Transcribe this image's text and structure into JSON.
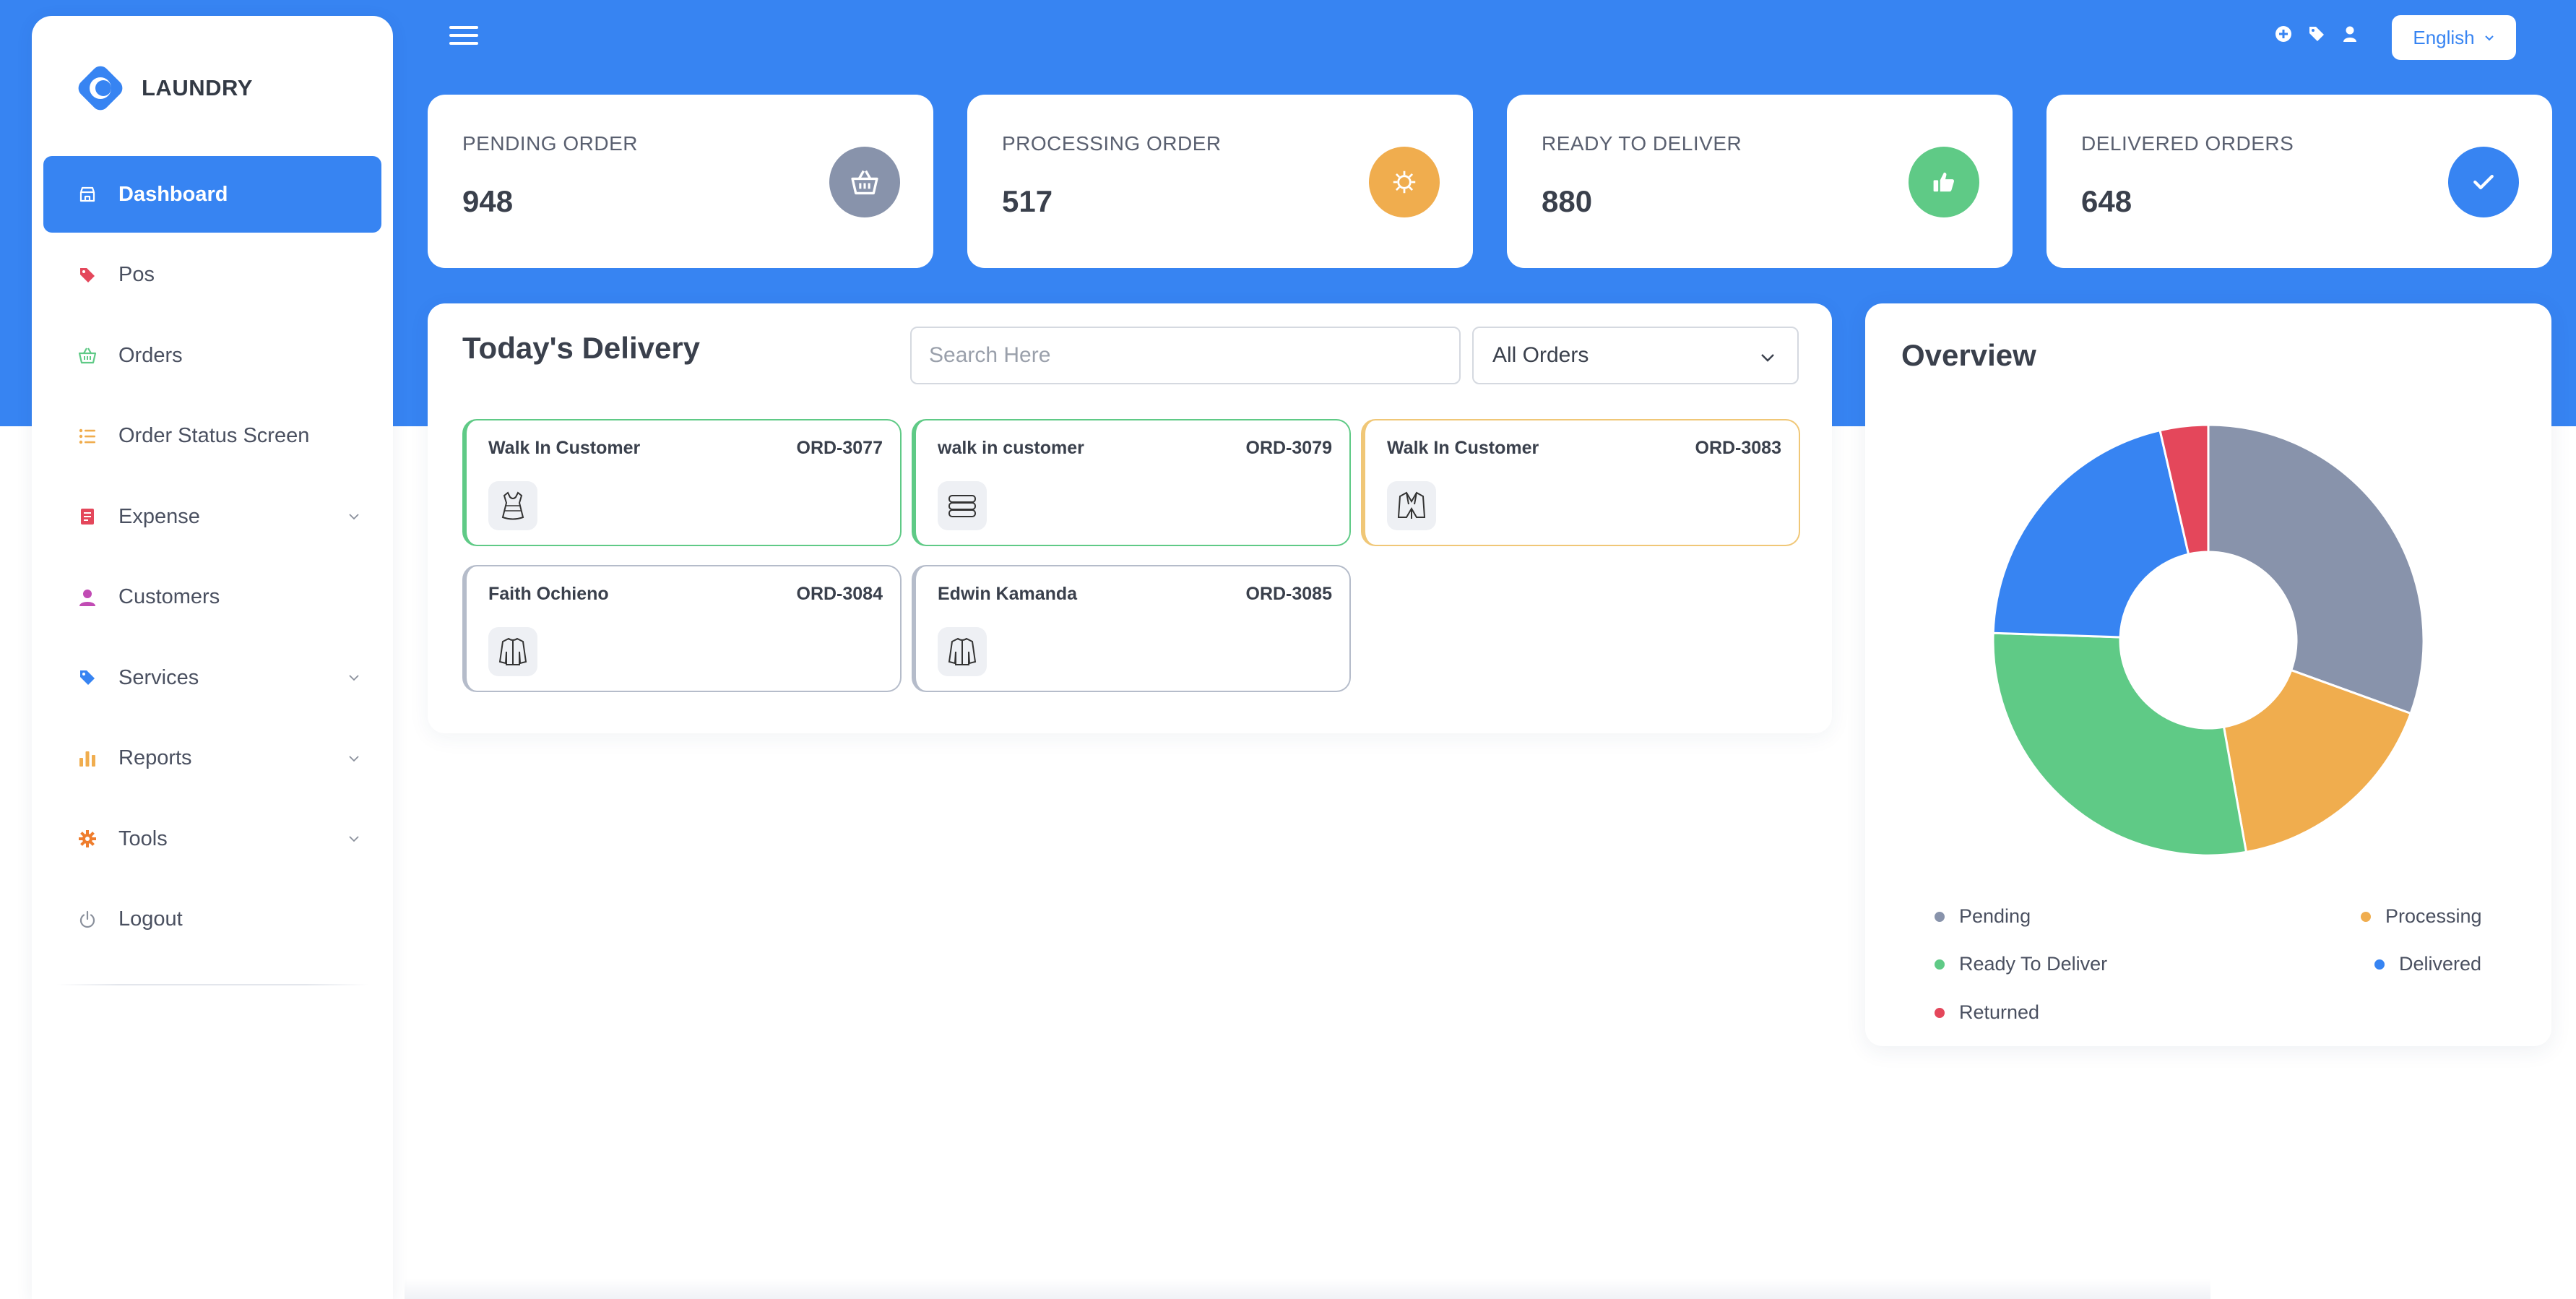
{
  "brand": {
    "name": "LAUNDRY"
  },
  "sidebar": {
    "items": [
      {
        "label": "Dashboard",
        "icon": "store-icon",
        "active": true,
        "expandable": false
      },
      {
        "label": "Pos",
        "icon": "tag-icon",
        "active": false,
        "expandable": false
      },
      {
        "label": "Orders",
        "icon": "basket-icon",
        "active": false,
        "expandable": false
      },
      {
        "label": "Order Status Screen",
        "icon": "list-icon",
        "active": false,
        "expandable": false
      },
      {
        "label": "Expense",
        "icon": "receipt-icon",
        "active": false,
        "expandable": true
      },
      {
        "label": "Customers",
        "icon": "user-icon",
        "active": false,
        "expandable": false
      },
      {
        "label": "Services",
        "icon": "tag-icon",
        "active": false,
        "expandable": true
      },
      {
        "label": "Reports",
        "icon": "bar-chart-icon",
        "active": false,
        "expandable": true
      },
      {
        "label": "Tools",
        "icon": "gear-icon",
        "active": false,
        "expandable": true
      },
      {
        "label": "Logout",
        "icon": "power-icon",
        "active": false,
        "expandable": false
      }
    ]
  },
  "topbar": {
    "language": "English"
  },
  "stats": [
    {
      "title": "PENDING ORDER",
      "value": "948",
      "icon": "basket-icon",
      "color": "#8893ab"
    },
    {
      "title": "PROCESSING ORDER",
      "value": "517",
      "icon": "gear-icon",
      "color": "#f0ad4e"
    },
    {
      "title": "READY TO DELIVER",
      "value": "880",
      "icon": "thumbs-up-icon",
      "color": "#5fca86"
    },
    {
      "title": "DELIVERED ORDERS",
      "value": "648",
      "icon": "check-icon",
      "color": "#3784f2"
    }
  ],
  "delivery": {
    "title": "Today's Delivery",
    "search_placeholder": "Search Here",
    "filter_value": "All Orders",
    "orders": [
      {
        "customer": "Walk In Customer",
        "id": "ORD-3077",
        "status": "ready",
        "item": "dress-icon"
      },
      {
        "customer": "walk in customer",
        "id": "ORD-3079",
        "status": "ready",
        "item": "folded-towels-icon"
      },
      {
        "customer": "Walk In Customer",
        "id": "ORD-3083",
        "status": "processing",
        "item": "suit-jacket-icon"
      },
      {
        "customer": "Faith Ochieno",
        "id": "ORD-3084",
        "status": "pending",
        "item": "jacket-icon"
      },
      {
        "customer": "Edwin Kamanda",
        "id": "ORD-3085",
        "status": "pending",
        "item": "jacket-icon"
      }
    ]
  },
  "overview": {
    "title": "Overview",
    "legend": [
      {
        "label": "Pending",
        "color": "#8893ab"
      },
      {
        "label": "Processing",
        "color": "#f0ad4e"
      },
      {
        "label": "Ready To Deliver",
        "color": "#5fca86"
      },
      {
        "label": "Delivered",
        "color": "#3784f2"
      },
      {
        "label": "Returned",
        "color": "#e4475b"
      }
    ]
  },
  "colors": {
    "primary": "#3784f2",
    "pending": "#8893ab",
    "processing": "#f0ad4e",
    "ready": "#5fca86",
    "delivered": "#3784f2",
    "returned": "#e4475b"
  },
  "chart_data": {
    "type": "pie",
    "categories": [
      "Pending",
      "Processing",
      "Ready To Deliver",
      "Delivered",
      "Returned"
    ],
    "values": [
      948,
      517,
      880,
      648,
      112
    ],
    "donut": true,
    "title": "Overview",
    "legend_placement": "bottom"
  }
}
